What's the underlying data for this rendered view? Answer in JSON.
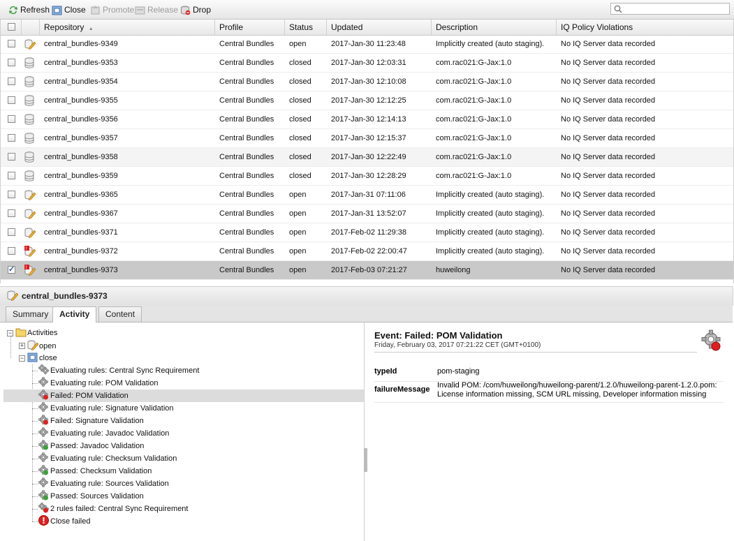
{
  "toolbar": {
    "refresh": "Refresh",
    "close": "Close",
    "promote": "Promote",
    "release": "Release",
    "drop": "Drop",
    "search_placeholder": ""
  },
  "columns": {
    "repository": "Repository",
    "profile": "Profile",
    "status": "Status",
    "updated": "Updated",
    "description": "Description",
    "iq": "IQ Policy Violations"
  },
  "rows": [
    {
      "repo": "central_bundles-9349",
      "profile": "Central Bundles",
      "status": "open",
      "updated": "2017-Jan-30 11:23:48",
      "desc": "Implicitly created (auto staging).",
      "iq": "No IQ Server data recorded",
      "icon": "repo-open-icon",
      "checked": false
    },
    {
      "repo": "central_bundles-9353",
      "profile": "Central Bundles",
      "status": "closed",
      "updated": "2017-Jan-30 12:03:31",
      "desc": "com.rac021:G-Jax:1.0",
      "iq": "No IQ Server data recorded",
      "icon": "repo-closed-icon",
      "checked": false
    },
    {
      "repo": "central_bundles-9354",
      "profile": "Central Bundles",
      "status": "closed",
      "updated": "2017-Jan-30 12:10:08",
      "desc": "com.rac021:G-Jax:1.0",
      "iq": "No IQ Server data recorded",
      "icon": "repo-closed-icon",
      "checked": false
    },
    {
      "repo": "central_bundles-9355",
      "profile": "Central Bundles",
      "status": "closed",
      "updated": "2017-Jan-30 12:12:25",
      "desc": "com.rac021:G-Jax:1.0",
      "iq": "No IQ Server data recorded",
      "icon": "repo-closed-icon",
      "checked": false
    },
    {
      "repo": "central_bundles-9356",
      "profile": "Central Bundles",
      "status": "closed",
      "updated": "2017-Jan-30 12:14:13",
      "desc": "com.rac021:G-Jax:1.0",
      "iq": "No IQ Server data recorded",
      "icon": "repo-closed-icon",
      "checked": false
    },
    {
      "repo": "central_bundles-9357",
      "profile": "Central Bundles",
      "status": "closed",
      "updated": "2017-Jan-30 12:15:37",
      "desc": "com.rac021:G-Jax:1.0",
      "iq": "No IQ Server data recorded",
      "icon": "repo-closed-icon",
      "checked": false
    },
    {
      "repo": "central_bundles-9358",
      "profile": "Central Bundles",
      "status": "closed",
      "updated": "2017-Jan-30 12:22:49",
      "desc": "com.rac021:G-Jax:1.0",
      "iq": "No IQ Server data recorded",
      "icon": "repo-closed-icon",
      "checked": false
    },
    {
      "repo": "central_bundles-9359",
      "profile": "Central Bundles",
      "status": "closed",
      "updated": "2017-Jan-30 12:28:29",
      "desc": "com.rac021:G-Jax:1.0",
      "iq": "No IQ Server data recorded",
      "icon": "repo-closed-icon",
      "checked": false
    },
    {
      "repo": "central_bundles-9365",
      "profile": "Central Bundles",
      "status": "open",
      "updated": "2017-Jan-31 07:11:06",
      "desc": "Implicitly created (auto staging).",
      "iq": "No IQ Server data recorded",
      "icon": "repo-open-icon",
      "checked": false
    },
    {
      "repo": "central_bundles-9367",
      "profile": "Central Bundles",
      "status": "open",
      "updated": "2017-Jan-31 13:52:07",
      "desc": "Implicitly created (auto staging).",
      "iq": "No IQ Server data recorded",
      "icon": "repo-open-icon",
      "checked": false
    },
    {
      "repo": "central_bundles-9371",
      "profile": "Central Bundles",
      "status": "open",
      "updated": "2017-Feb-02 11:29:38",
      "desc": "Implicitly created (auto staging).",
      "iq": "No IQ Server data recorded",
      "icon": "repo-open-icon",
      "checked": false
    },
    {
      "repo": "central_bundles-9372",
      "profile": "Central Bundles",
      "status": "open",
      "updated": "2017-Feb-02 22:00:47",
      "desc": "Implicitly created (auto staging).",
      "iq": "No IQ Server data recorded",
      "icon": "repo-open-error-icon",
      "checked": false
    },
    {
      "repo": "central_bundles-9373",
      "profile": "Central Bundles",
      "status": "open",
      "updated": "2017-Feb-03 07:21:27",
      "desc": "huweilong",
      "iq": "No IQ Server data recorded",
      "icon": "repo-open-error-icon",
      "checked": true
    }
  ],
  "panel": {
    "title": "central_bundles-9373",
    "tabs": [
      "Summary",
      "Activity",
      "Content"
    ],
    "active_tab": "Activity"
  },
  "tree": {
    "root": "Activities",
    "open": "open",
    "close": "close",
    "items": [
      {
        "label": "Evaluating rules: Central Sync Requirement",
        "icon": "gears-icon"
      },
      {
        "label": "Evaluating rule: POM Validation",
        "icon": "gear-icon"
      },
      {
        "label": "Failed: POM Validation",
        "icon": "gear-failed-icon"
      },
      {
        "label": "Evaluating rule: Signature Validation",
        "icon": "gear-icon"
      },
      {
        "label": "Failed: Signature Validation",
        "icon": "gear-failed-icon"
      },
      {
        "label": "Evaluating rule: Javadoc Validation",
        "icon": "gear-icon"
      },
      {
        "label": "Passed: Javadoc Validation",
        "icon": "gear-passed-icon"
      },
      {
        "label": "Evaluating rule: Checksum Validation",
        "icon": "gear-icon"
      },
      {
        "label": "Passed: Checksum Validation",
        "icon": "gear-passed-icon"
      },
      {
        "label": "Evaluating rule: Sources Validation",
        "icon": "gear-icon"
      },
      {
        "label": "Passed: Sources Validation",
        "icon": "gear-passed-icon"
      },
      {
        "label": "2 rules failed: Central Sync Requirement",
        "icon": "gears-failed-icon"
      },
      {
        "label": "Close failed",
        "icon": "error-icon"
      }
    ]
  },
  "detail": {
    "title": "Event: Failed: POM Validation",
    "subtitle": "Friday, February 03, 2017 07:21:22 CET (GMT+0100)",
    "typeid_key": "typeId",
    "typeid_val": "pom-staging",
    "failure_key": "failureMessage",
    "failure_val": "Invalid POM: /com/huweilong/huweilong-parent/1.2.0/huweilong-parent-1.2.0.pom: License information missing, SCM URL missing, Developer information missing"
  },
  "colors": {
    "selected_row": "#c9c9c9",
    "error_red": "#e02020",
    "pass_green": "#3aa23a"
  }
}
